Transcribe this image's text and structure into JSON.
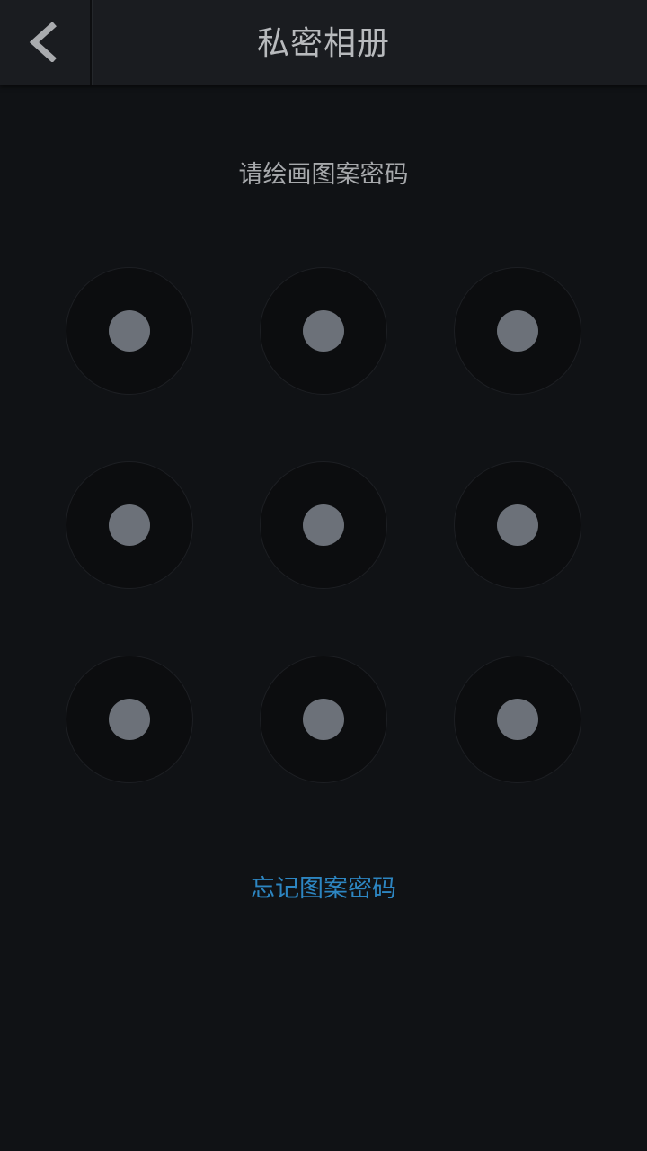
{
  "header": {
    "title": "私密相册",
    "back_icon": "chevron-left-icon"
  },
  "prompt": "请绘画图案密码",
  "pattern": {
    "rows": 3,
    "cols": 3,
    "nodes": [
      1,
      2,
      3,
      4,
      5,
      6,
      7,
      8,
      9
    ]
  },
  "forgot_link": "忘记图案密码",
  "colors": {
    "background": "#101215",
    "header": "#1a1c20",
    "dot": "#6c7179",
    "link": "#2d86c2"
  }
}
